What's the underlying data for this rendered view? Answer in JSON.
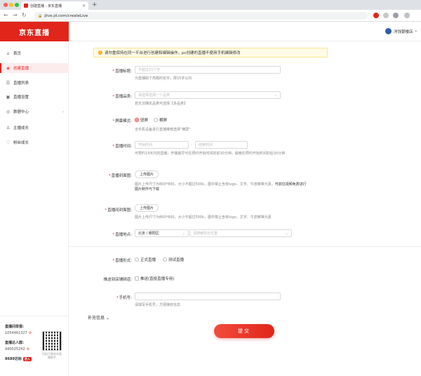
{
  "browser": {
    "tab_title": "创建直播 - 京东直播",
    "tab_close": "×",
    "new_tab": "+",
    "back": "←",
    "forward": "→",
    "reload": "↻",
    "url": "jlive.jd.com/createLive",
    "lock": "🔒"
  },
  "brand": {
    "logo_text": "京东直播",
    "color": "#e1251b"
  },
  "header": {
    "shop_name": "洋钱银楼店",
    "chevron": "▾"
  },
  "sidebar": {
    "items": [
      {
        "icon": "⌂",
        "label": "首页"
      },
      {
        "icon": "◈",
        "label": "创建直播"
      },
      {
        "icon": "☰",
        "label": "直播列表"
      },
      {
        "icon": "▣",
        "label": "直播设置"
      },
      {
        "icon": "◎",
        "label": "数据中心",
        "chevron": "⌄"
      },
      {
        "icon": "♙",
        "label": "主播成长"
      },
      {
        "icon": "♡",
        "label": "粉丝成长"
      }
    ],
    "footer": {
      "hotline_label": "直播间举报:",
      "hotline_number": "1054461327",
      "join_label": "直播达人群:",
      "join_number": "940025242",
      "ok_label": "8689达标",
      "in_badge": "进入",
      "copy_icon": "⊘",
      "qr_caption": "扫码下载京东直播助手"
    }
  },
  "notice": {
    "icon": "!",
    "text": "请勿重保持在同一平台进行创建和编辑操作，pc创建的直播不便用手机编辑修改"
  },
  "form": {
    "title": {
      "label": "直播标题:",
      "placeholder": "不超过15个字",
      "hint": "为直播取个亮眼的名字，限15字以内"
    },
    "category": {
      "label": "直播品类:",
      "placeholder": "请选择选择一个品类",
      "hint": "若无法确定品类可选择【多品类】"
    },
    "screen_mode": {
      "label": "屏幕模式:",
      "options": [
        "竖屏",
        "横屏"
      ],
      "selected": 0,
      "hint": "全手机设备进行直播推荐选择\"横屏\""
    },
    "time": {
      "label": "直播时间:",
      "start_placeholder": "开始时间",
      "end_placeholder": "结束时间",
      "hint": "可预约14天内的直播，开播最早可在预约开始时间的前30分钟，最晚在预约开始时间的后30分钟"
    },
    "cover": {
      "label": "直播封面图:",
      "button": "上传图片",
      "hint_plain": "图片上传尺寸为800*800，大小不超过500k，图中禁止含有logo、文字、牛皮癣等元素。",
      "hint_dark": "可前往视频免费进行图片制作与下载"
    },
    "room_cover": {
      "label": "直播间封面图:",
      "button": "上传图片",
      "hint": "图片上传尺寸为800*800，大小不超过500k，图中禁止含有logo、文字、牛皮癣等元素"
    },
    "location": {
      "label": "直播地点:",
      "value": "北京 / 朝阳区",
      "placeholder": "请搜索附近位置"
    },
    "live_type": {
      "label": "直播形式:",
      "options": [
        "正式直播",
        "测试直播"
      ]
    },
    "push": {
      "label": "推送到店铺频道:",
      "option": "推送(直投直播专用)"
    },
    "phone": {
      "label": "手机号:",
      "hint": "请填写手机号，方便接收信息"
    }
  },
  "supplement": {
    "label": "补充信息",
    "chevron": "⌄"
  },
  "submit": {
    "label": "提交"
  }
}
